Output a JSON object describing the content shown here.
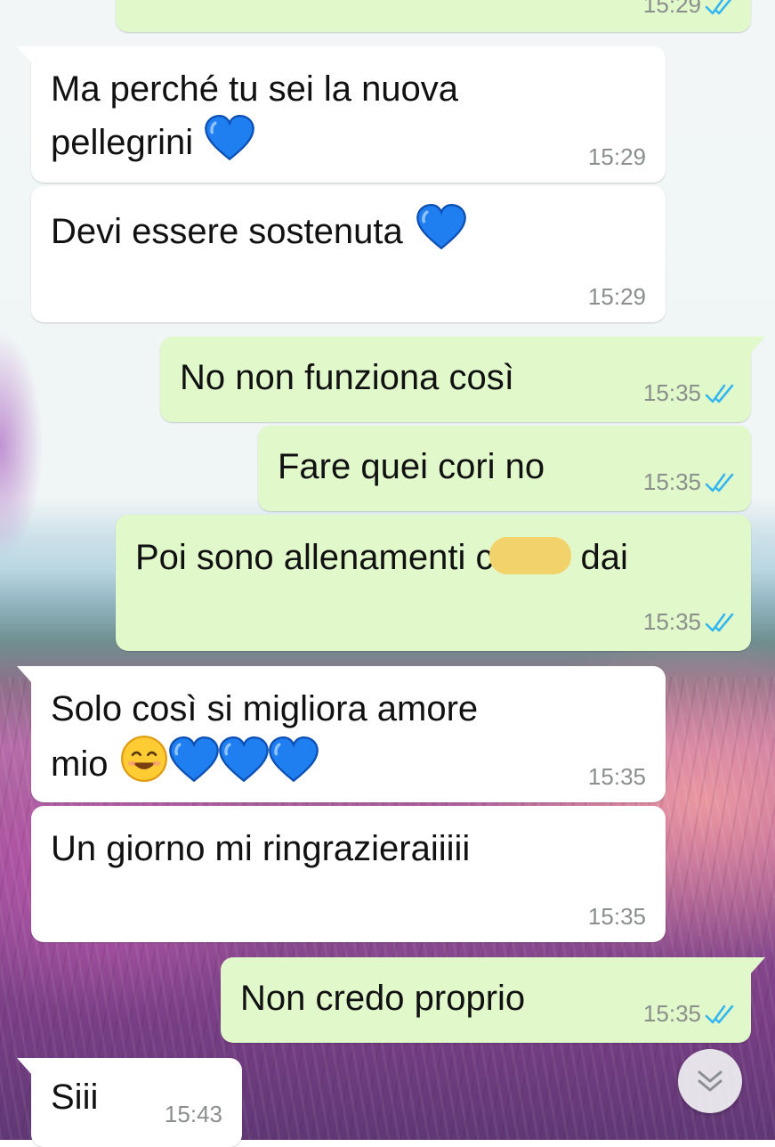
{
  "colors": {
    "incoming_bubble": "#ffffff",
    "outgoing_bubble": "#e1f8cb",
    "read_ticks": "#34b7f1",
    "timestamp": "#8a8f8c",
    "redaction_marker": "#f2d36b"
  },
  "messages": [
    {
      "direction": "outgoing",
      "text": "",
      "time": "15:29",
      "status": "read"
    },
    {
      "direction": "incoming",
      "text": "Ma perché tu sei la nuova\npellegrini",
      "emoji": [
        "blue-heart"
      ],
      "time": "15:29"
    },
    {
      "direction": "incoming",
      "text": "Devi essere sostenuta",
      "emoji": [
        "blue-heart"
      ],
      "time": "15:29"
    },
    {
      "direction": "outgoing",
      "text": "No non funziona così",
      "time": "15:35",
      "status": "read"
    },
    {
      "direction": "outgoing",
      "text": "Fare quei cori no",
      "time": "15:35",
      "status": "read"
    },
    {
      "direction": "outgoing",
      "text": "Poi sono allenamenti c",
      "text_after_redaction": "dai",
      "time": "15:35",
      "status": "read"
    },
    {
      "direction": "incoming",
      "text": "Solo così si migliora amore\nmio",
      "emoji": [
        "smiling-face",
        "blue-heart",
        "blue-heart",
        "blue-heart"
      ],
      "time": "15:35"
    },
    {
      "direction": "incoming",
      "text": "Un giorno mi ringrazieraiiiii",
      "time": "15:35"
    },
    {
      "direction": "outgoing",
      "text": "Non credo proprio",
      "time": "15:35",
      "status": "read"
    },
    {
      "direction": "incoming",
      "text": "Siii",
      "time": "15:43"
    }
  ],
  "scroll_button": {
    "icon": "double-chevron-down-icon"
  }
}
